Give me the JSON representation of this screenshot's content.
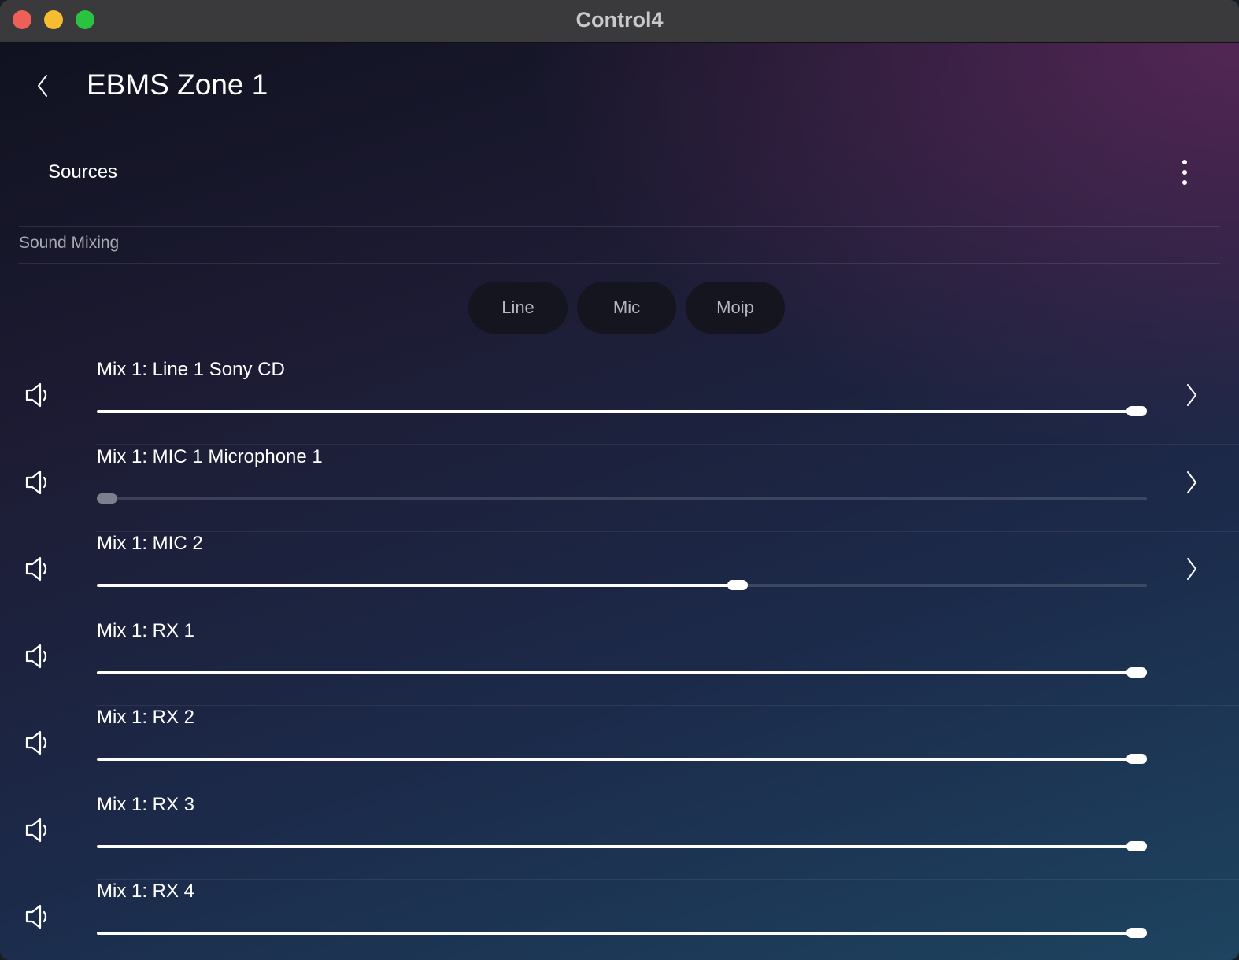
{
  "window": {
    "title": "Control4"
  },
  "header": {
    "title": "EBMS Zone 1"
  },
  "sources": {
    "label": "Sources"
  },
  "section": {
    "label": "Sound Mixing"
  },
  "tabs": [
    {
      "label": "Line"
    },
    {
      "label": "Mic"
    },
    {
      "label": "Moip"
    }
  ],
  "icons": {
    "back": "chevron-left-icon",
    "menu": "more-vertical-icon",
    "speaker": "speaker-icon",
    "row_nav": "chevron-right-icon"
  },
  "colors": {
    "close": "#ee5f57",
    "minimize": "#f5bd2f",
    "maximize": "#29c340",
    "slider_fill": "#ffffff",
    "slider_muted_thumb": "#7b808c"
  },
  "mixes": [
    {
      "label": "Mix 1: Line 1 Sony CD",
      "level_percent": 100,
      "has_details": true
    },
    {
      "label": "Mix 1: MIC 1 Microphone 1",
      "level_percent": 0,
      "has_details": true
    },
    {
      "label": "Mix 1: MIC 2",
      "level_percent": 62,
      "has_details": true
    },
    {
      "label": "Mix 1: RX 1",
      "level_percent": 100,
      "has_details": false
    },
    {
      "label": "Mix 1: RX 2",
      "level_percent": 100,
      "has_details": false
    },
    {
      "label": "Mix 1: RX 3",
      "level_percent": 100,
      "has_details": false
    },
    {
      "label": "Mix 1: RX 4",
      "level_percent": 100,
      "has_details": false
    }
  ]
}
